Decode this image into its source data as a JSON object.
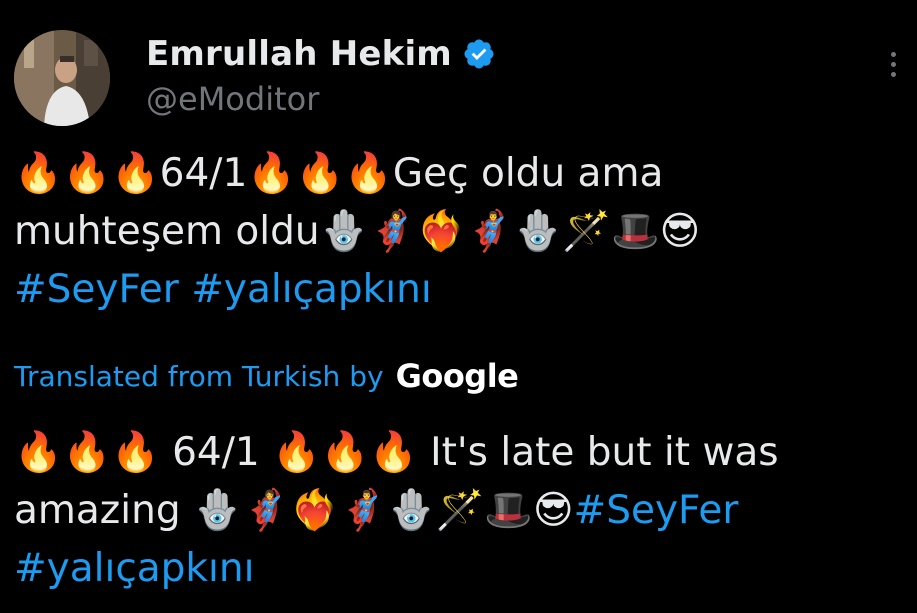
{
  "author": {
    "display_name": "Emrullah Hekim",
    "handle": "@eModitor",
    "verified": true
  },
  "tweet": {
    "original_lines": [
      "🔥🔥🔥64/1🔥🔥🔥Geç oldu ama",
      "muhteşem oldu🪬🦸‍♀️❤️‍🔥🦸‍♂️🪬🪄🎩😎"
    ],
    "original_hashtags": [
      "#SeyFer",
      "#yalıçapkını"
    ],
    "translated_by_label": "Translated from Turkish by",
    "translated_by_brand": "Google",
    "translation_lines": [
      "🔥🔥🔥 64/1 🔥🔥🔥 It's late but it was",
      "amazing 🪬🦸‍♀️❤️‍🔥🦸‍♂️🪬🪄🎩😎"
    ],
    "translation_hashtags": [
      "#SeyFer",
      "#yalıçapkını"
    ]
  },
  "icons": {
    "verified": "verified-badge-icon",
    "more": "more-options-icon"
  },
  "colors": {
    "background": "#000000",
    "text": "#e7e9ea",
    "secondary": "#71767b",
    "accent": "#1d9bf0"
  }
}
